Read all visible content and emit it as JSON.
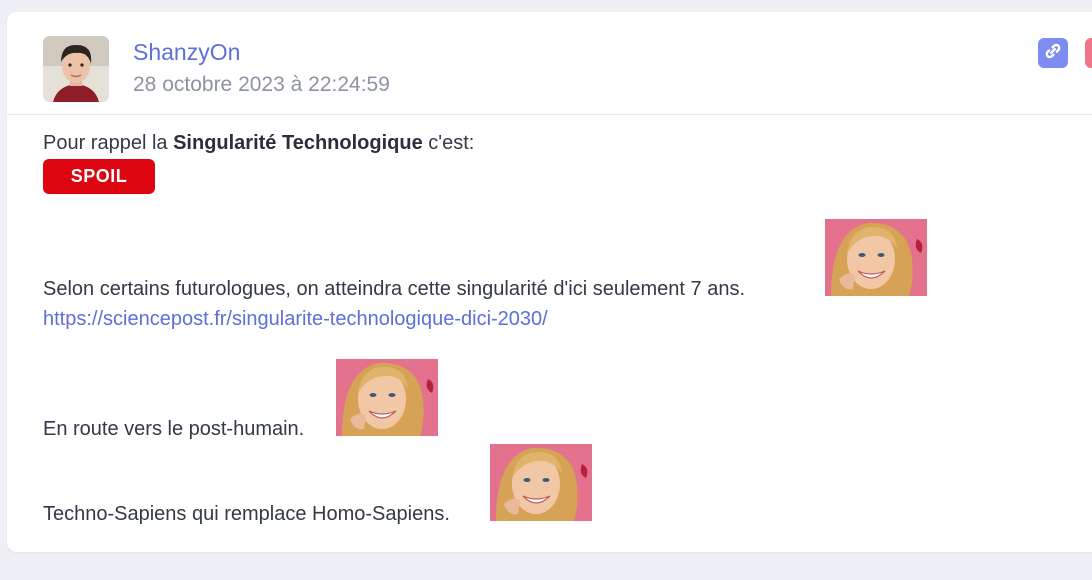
{
  "post": {
    "author": "ShanzyOn",
    "date": "28 octobre 2023 à 22:24:59",
    "intro_prefix": "Pour rappel la ",
    "intro_bold": "Singularité Technologique",
    "intro_suffix": " c'est:",
    "spoil_label": "SPOIL",
    "paragraph1": "Selon certains futurologues, on atteindra cette singularité d'ici seulement 7 ans.",
    "link": "https://sciencepost.fr/singularite-technologique-dici-2030/",
    "paragraph2": "En route vers le post-humain.",
    "paragraph3": "Techno-Sapiens qui remplace Homo-Sapiens."
  },
  "icons": {
    "permalink": "link-icon",
    "report": "report-icon",
    "avatar": "avatar",
    "emoticon": "smiley-image"
  },
  "colors": {
    "page_background": "#eef0f5",
    "username": "#5d6fd9",
    "link": "#5d6fd9",
    "spoil": "#dc0510",
    "permalink_button": "#7c8cf0",
    "report_button": "#f07588"
  }
}
